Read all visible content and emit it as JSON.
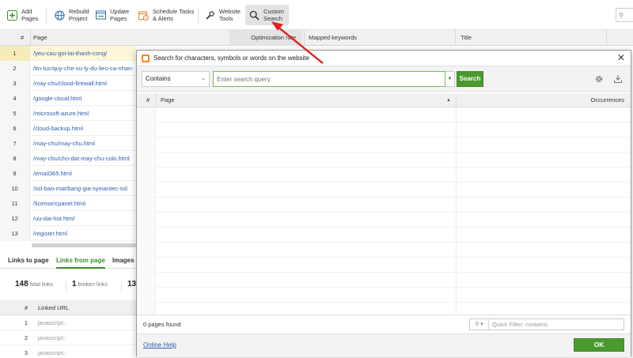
{
  "toolbar": {
    "add_pages": "Add\nPages",
    "rebuild_project": "Rebuild\nProject",
    "update_pages": "Update\nPages",
    "schedule_tasks": "Schedule Tasks\n& Alerts",
    "website_tools": "Website\nTools",
    "custom_search": "Custom\nSearch"
  },
  "grid": {
    "columns": [
      "#",
      "Page",
      "Optimization rate",
      "Mapped keywords",
      "Title"
    ],
    "rows": [
      {
        "n": "1",
        "page": "/yeu-cau-goi-lai-thanh-cong/"
      },
      {
        "n": "2",
        "page": "/tin-tuc/quy-che-xu-ly-du-lieu-ca-nhan-"
      },
      {
        "n": "3",
        "page": "/may-chu/cloud-firewall.html"
      },
      {
        "n": "4",
        "page": "/google-cloud.html"
      },
      {
        "n": "5",
        "page": "/microsoft-azure.html"
      },
      {
        "n": "6",
        "page": "/cloud-backup.html"
      },
      {
        "n": "7",
        "page": "/may-chu/may-chu.html"
      },
      {
        "n": "8",
        "page": "/may-chu/cho-dat-may-chu-colo.html"
      },
      {
        "n": "9",
        "page": "/email365.html"
      },
      {
        "n": "10",
        "page": "/ssl-bao-mat/bang-gia-symantec-ssl."
      },
      {
        "n": "11",
        "page": "/license/cpanel.html"
      },
      {
        "n": "12",
        "page": "/uu-dai-hot.html"
      },
      {
        "n": "13",
        "page": "/register.html"
      }
    ]
  },
  "bottom": {
    "tabs": [
      "Links to page",
      "Links from page",
      "Images"
    ],
    "stats": [
      {
        "value": "148",
        "label": "total links"
      },
      {
        "value": "1",
        "label": "broken links"
      },
      {
        "value": "13",
        "label": ""
      }
    ],
    "columns": [
      "#",
      "Linked URL"
    ],
    "rows": [
      {
        "n": "1",
        "url": "javascript:;"
      },
      {
        "n": "2",
        "url": "javascript:;"
      },
      {
        "n": "3",
        "url": "javascript:;"
      }
    ]
  },
  "dialog": {
    "title": "Search for characters, symbols or words on the website",
    "mode": "Contains",
    "query_placeholder": "Enter search query",
    "search_label": "Search",
    "columns": [
      "#",
      "Page",
      "Occurrences"
    ],
    "count": "0 pages found",
    "quick_filter": "Quick Filter: contains",
    "help": "Online Help",
    "ok": "OK"
  },
  "colors": {
    "accent_green": "#4a9a2f",
    "link_blue": "#2a5db0",
    "arrow_red": "#e02020"
  }
}
